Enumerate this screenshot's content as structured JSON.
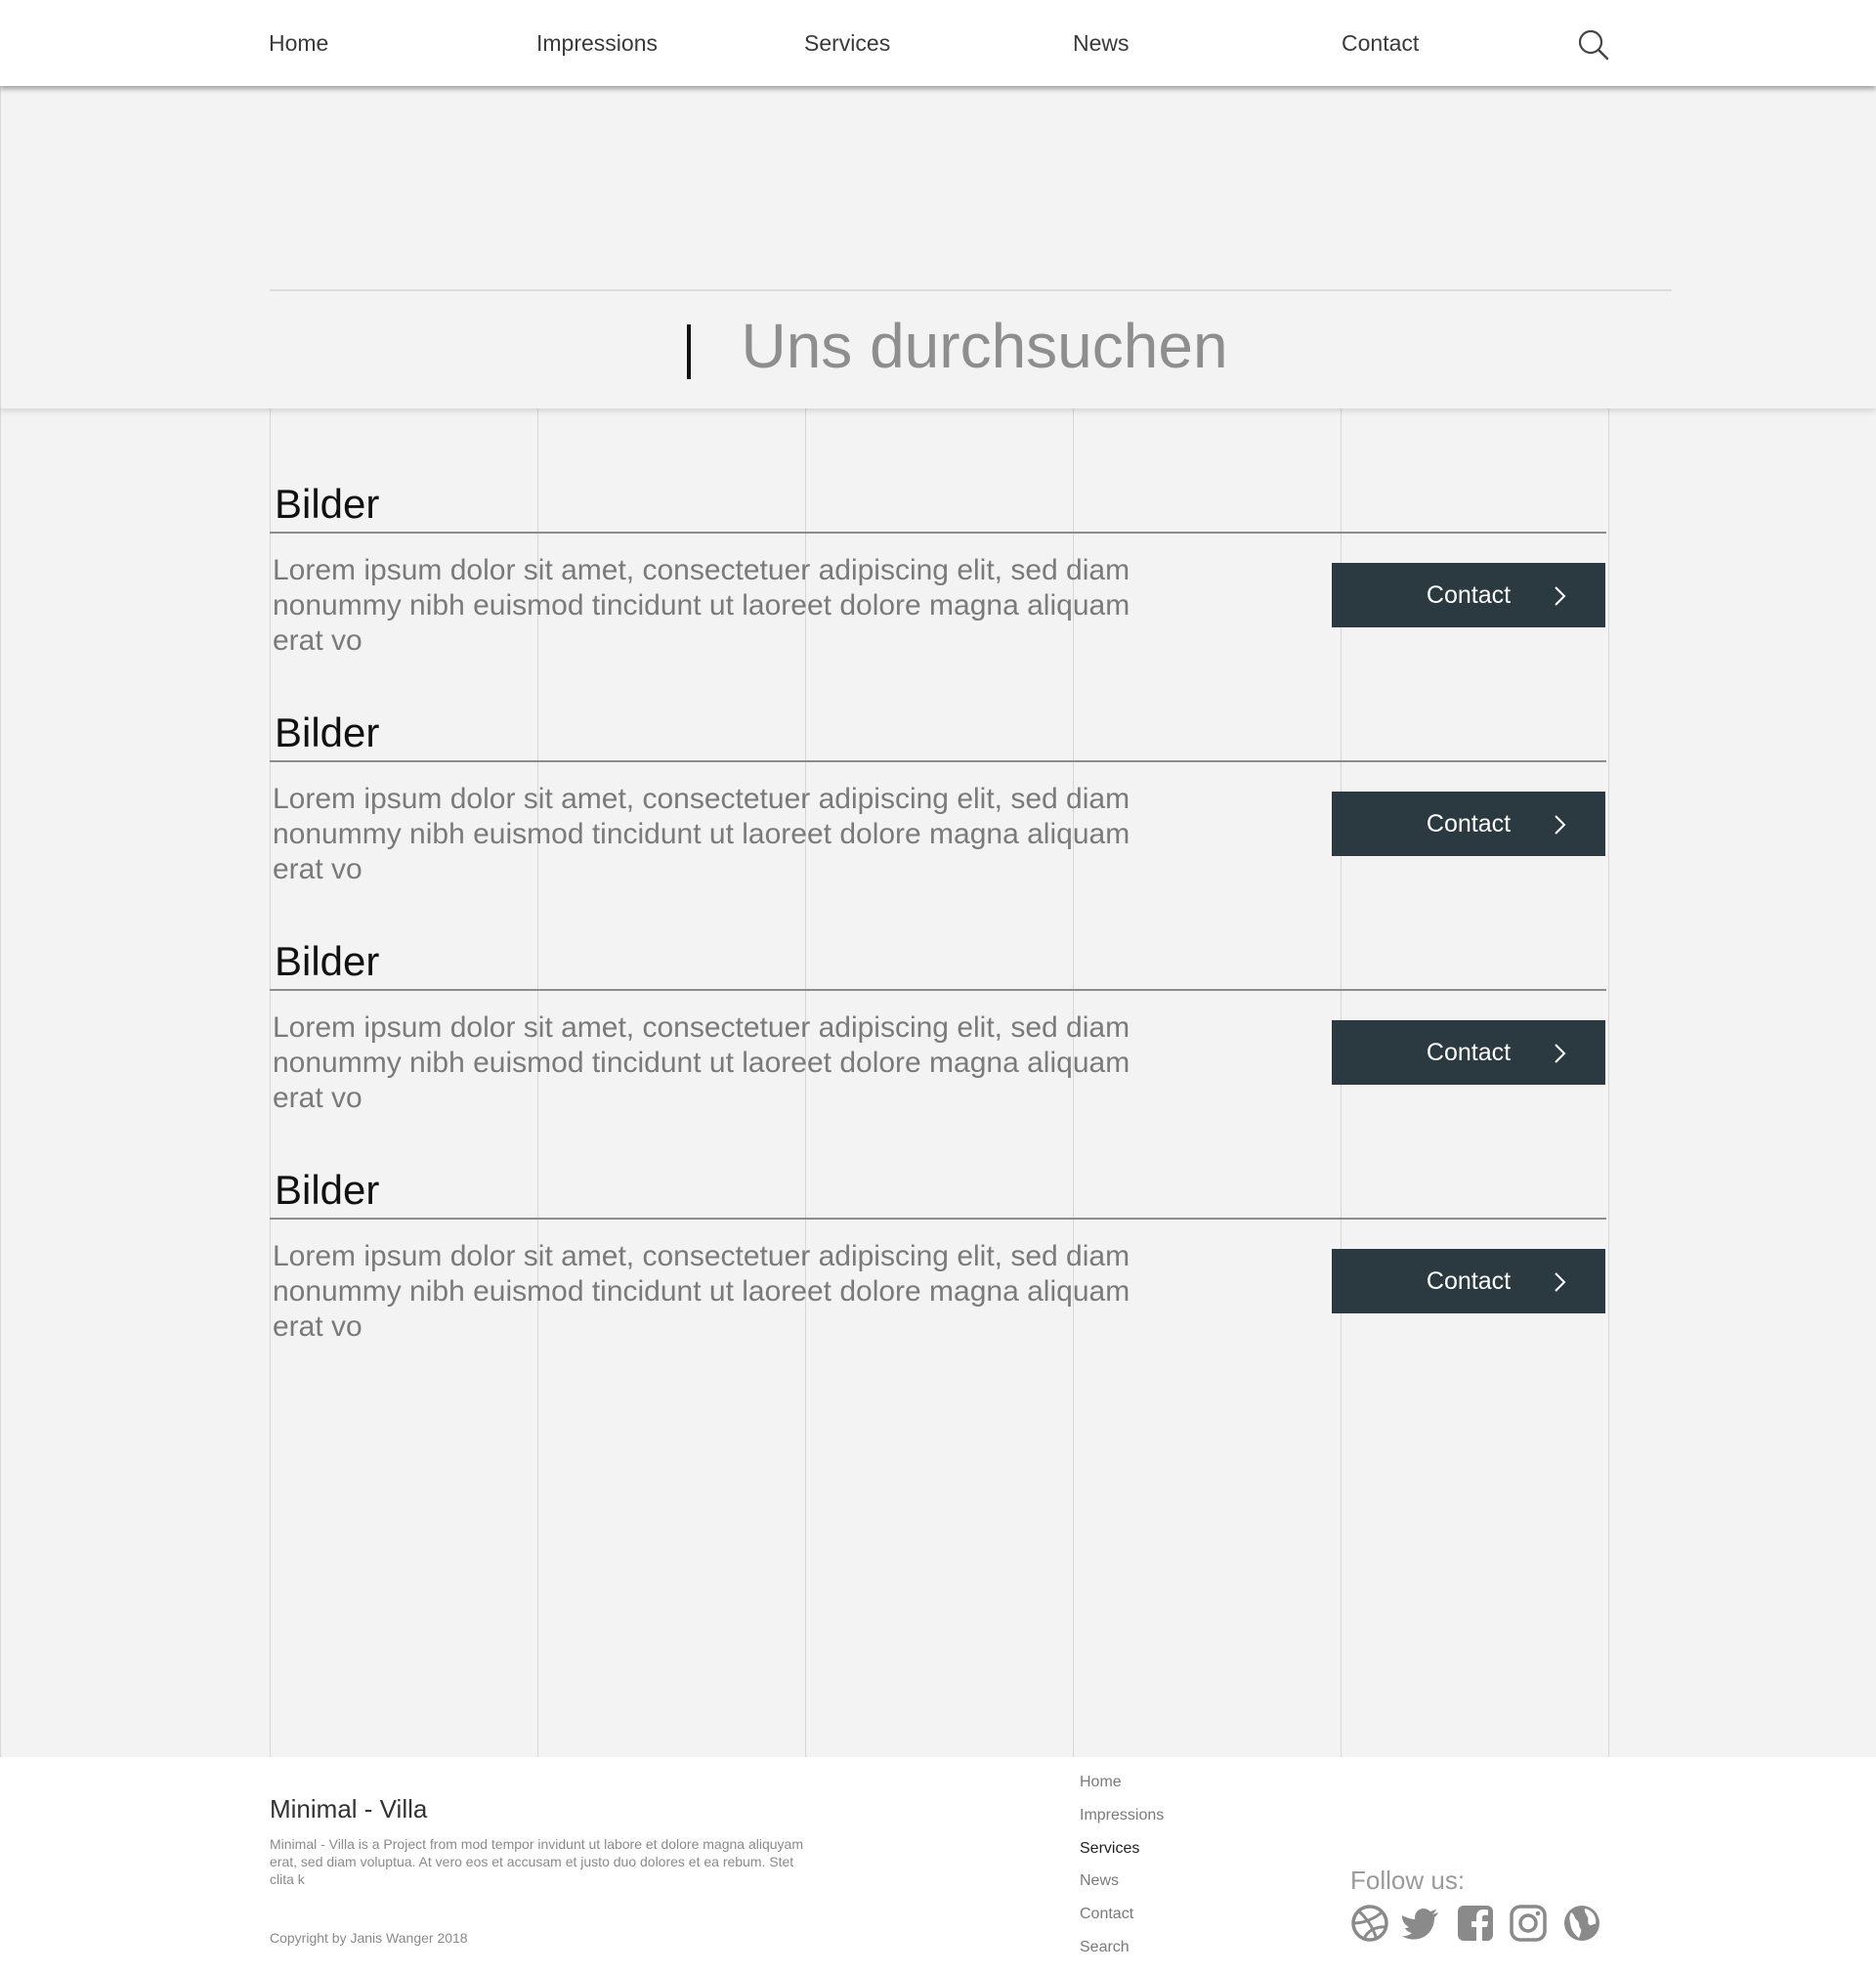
{
  "header": {
    "nav": [
      "Home",
      "Impressions",
      "Services",
      "News",
      "Contact"
    ],
    "search_icon": "search-icon"
  },
  "search": {
    "placeholder": "Uns durchsuchen"
  },
  "sections": [
    {
      "title": "Bilder",
      "text": "Lorem ipsum dolor sit amet, consectetuer adipiscing elit, sed diam nonummy nibh euismod tincidunt ut laoreet dolore magna aliquam erat vo",
      "button": "Contact"
    },
    {
      "title": "Bilder",
      "text": "Lorem ipsum dolor sit amet, consectetuer adipiscing elit, sed diam nonummy nibh euismod tincidunt ut laoreet dolore magna aliquam erat vo",
      "button": "Contact"
    },
    {
      "title": "Bilder",
      "text": "Lorem ipsum dolor sit amet, consectetuer adipiscing elit, sed diam nonummy nibh euismod tincidunt ut laoreet dolore magna aliquam erat vo",
      "button": "Contact"
    },
    {
      "title": "Bilder",
      "text": "Lorem ipsum dolor sit amet, consectetuer adipiscing elit, sed diam nonummy nibh euismod tincidunt ut laoreet dolore magna aliquam erat vo",
      "button": "Contact"
    }
  ],
  "footer": {
    "brand": "Minimal - Villa",
    "description": "Minimal - Villa  is a Project from mod tempor invidunt ut labore et dolore magna aliquyam erat, sed diam voluptua. At vero eos et accusam et justo duo dolores et ea rebum. Stet clita k",
    "copyright": "Copyright by Janis Wanger 2018",
    "nav": [
      "Home",
      "Impressions",
      "Services",
      "News",
      "Contact",
      "Search"
    ],
    "active_nav": "Services",
    "follow_label": "Follow us:",
    "social_icons": [
      "dribbble-icon",
      "twitter-icon",
      "facebook-icon",
      "instagram-icon",
      "globe-icon"
    ]
  },
  "colors": {
    "button_bg": "#2b3a40",
    "page_bg": "#f3f3f3",
    "grid_line": "#d6d6d6",
    "social_icon": "#8a8a8a"
  }
}
